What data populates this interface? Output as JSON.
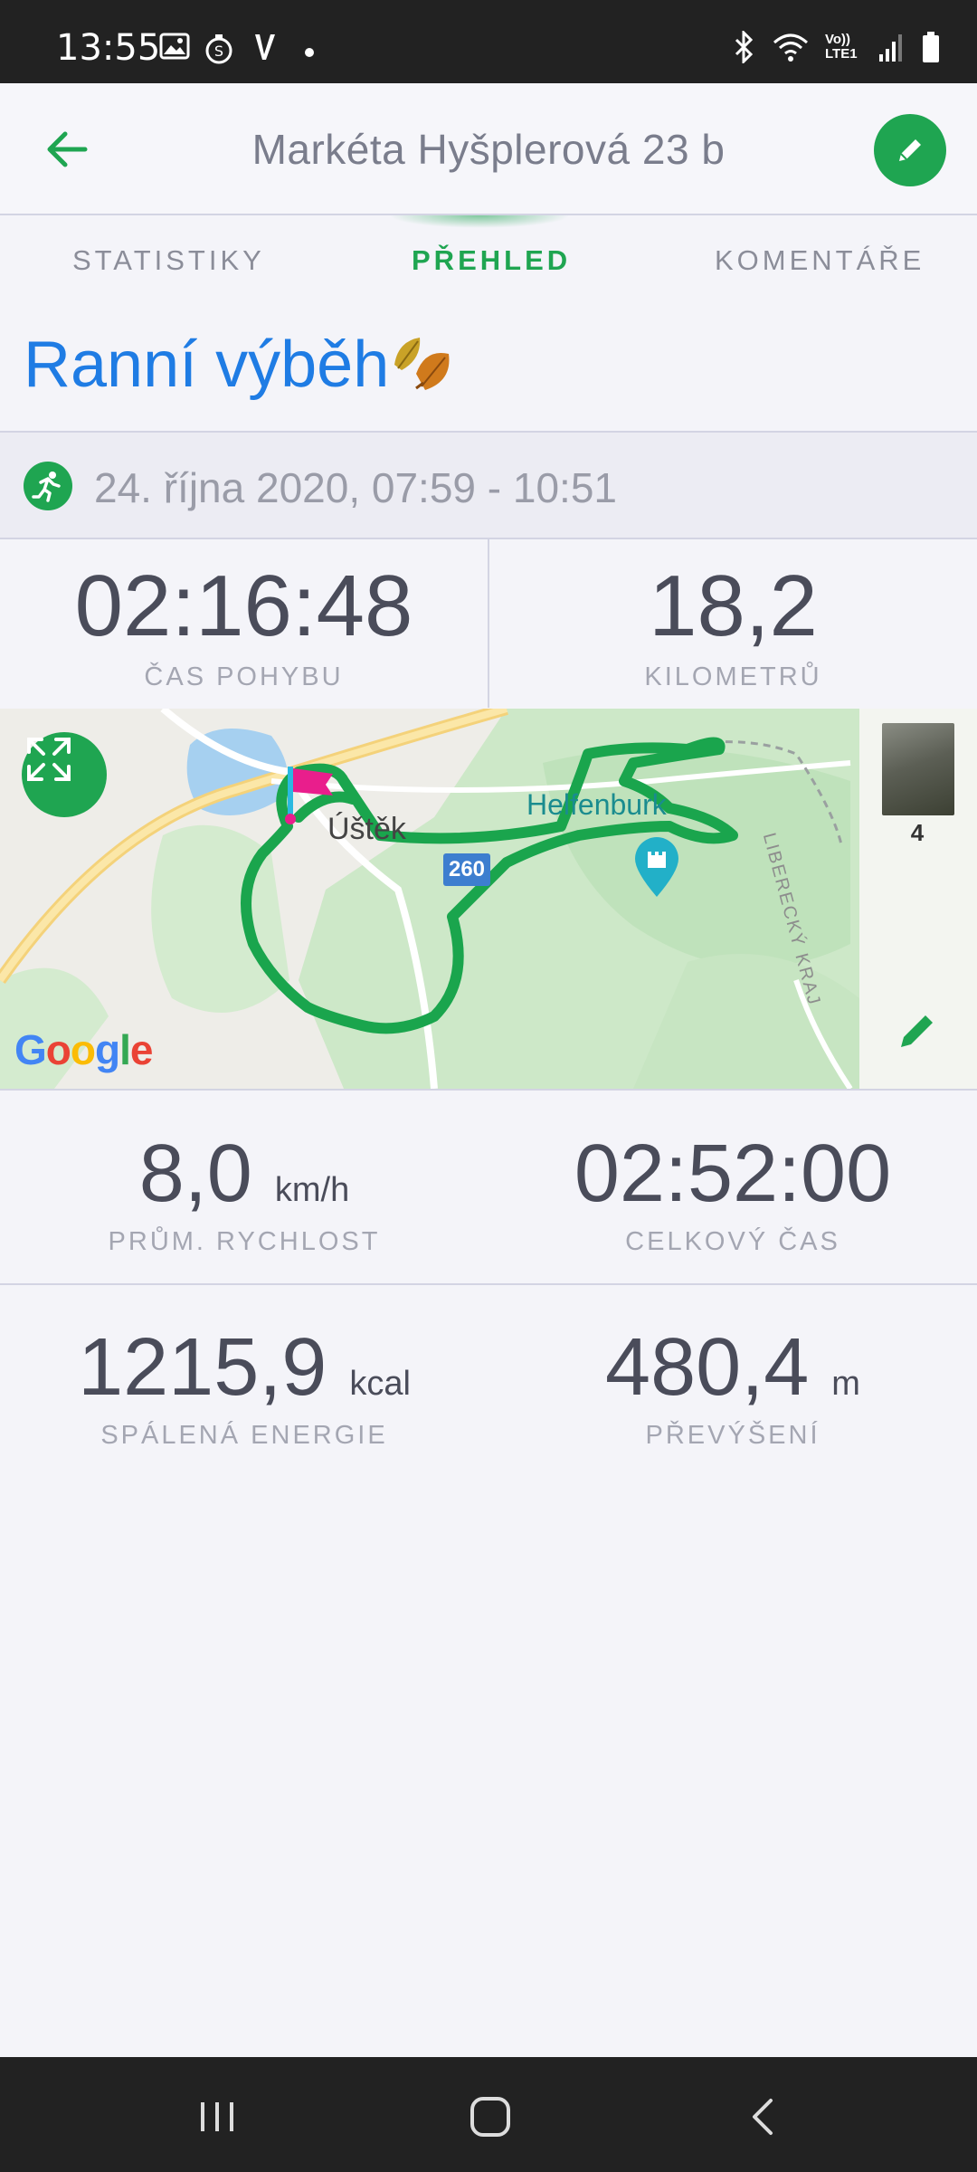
{
  "status_bar": {
    "time": "13:55",
    "network": "Vo)) LTE1"
  },
  "header": {
    "title": "Markéta Hyšplerová  23 b",
    "back_icon": "arrow-left-icon",
    "edit_icon": "pencil-icon"
  },
  "tabs": [
    {
      "label": "STATISTIKY",
      "active": false
    },
    {
      "label": "PŘEHLED",
      "active": true
    },
    {
      "label": "KOMENTÁŘE",
      "active": false
    }
  ],
  "activity": {
    "title": "Ranní výběh",
    "date": "24. října 2020, 07:59 - 10:51",
    "type_icon": "running-icon"
  },
  "stats_top": {
    "moving_time": {
      "value": "02:16:48",
      "label": "ČAS POHYBU"
    },
    "distance": {
      "value": "18,2",
      "label": "KILOMETRŮ"
    }
  },
  "map": {
    "town": "Úštěk",
    "poi": "Helfenburk",
    "road_number": "260",
    "region": "LIBERECKÝ KRAJ",
    "photo_count": "4",
    "attribution": "Google"
  },
  "stats_bottom": {
    "avg_speed": {
      "value": "8,0",
      "unit": "km/h",
      "label": "PRŮM. RYCHLOST"
    },
    "total_time": {
      "value": "02:52:00",
      "unit": "",
      "label": "CELKOVÝ ČAS"
    },
    "energy": {
      "value": "1215,9",
      "unit": "kcal",
      "label": "SPÁLENÁ ENERGIE"
    },
    "elevation": {
      "value": "480,4",
      "unit": "m",
      "label": "PŘEVÝŠENÍ"
    }
  },
  "colors": {
    "accent_green": "#1fa551",
    "title_blue": "#1f7ce4",
    "route_green": "#1aa54d"
  }
}
